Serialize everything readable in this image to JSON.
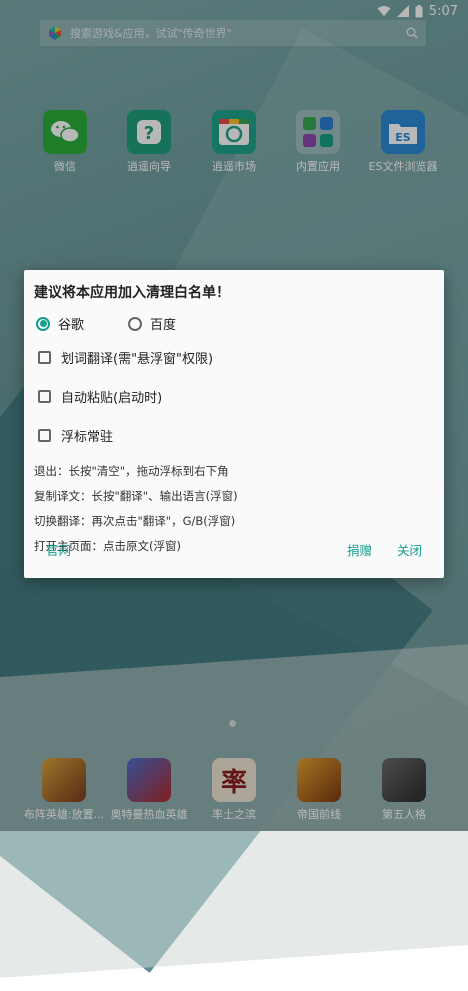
{
  "status_bar": {
    "time": "5:07"
  },
  "search": {
    "placeholder": "搜索游戏&应用，试试\"传奇世界\""
  },
  "apps": [
    {
      "label": "微信",
      "icon": "wechat-icon"
    },
    {
      "label": "逍遥向导",
      "icon": "help-icon"
    },
    {
      "label": "逍遥市场",
      "icon": "market-icon"
    },
    {
      "label": "内置应用",
      "icon": "folder-icon"
    },
    {
      "label": "ES文件浏览器",
      "icon": "es-file-icon"
    }
  ],
  "dock": [
    {
      "label": "布阵英雄:放置..."
    },
    {
      "label": "奥特曼热血英雄"
    },
    {
      "label": "率土之滨"
    },
    {
      "label": "帝国前线"
    },
    {
      "label": "第五人格"
    }
  ],
  "dialog": {
    "title": "建议将本应用加入清理白名单！",
    "radio_google": "谷歌",
    "radio_baidu": "百度",
    "check_word": "划词翻译(需\"悬浮窗\"权限)",
    "check_paste": "自动粘贴(启动时)",
    "check_float": "浮标常驻",
    "info_exit": "退出：长按\"清空\"，拖动浮标到右下角",
    "info_copy": "复制译文：长按\"翻译\"、输出语言(浮窗)",
    "info_switch": "切换翻译：再次点击\"翻译\"，G/B(浮窗)",
    "info_open": "打开主页面：点击原文(浮窗)",
    "btn_site": "官网",
    "btn_donate": "捐赠",
    "btn_close": "关闭",
    "selected_engine": "谷歌"
  },
  "colors": {
    "accent": "#159e8e"
  }
}
